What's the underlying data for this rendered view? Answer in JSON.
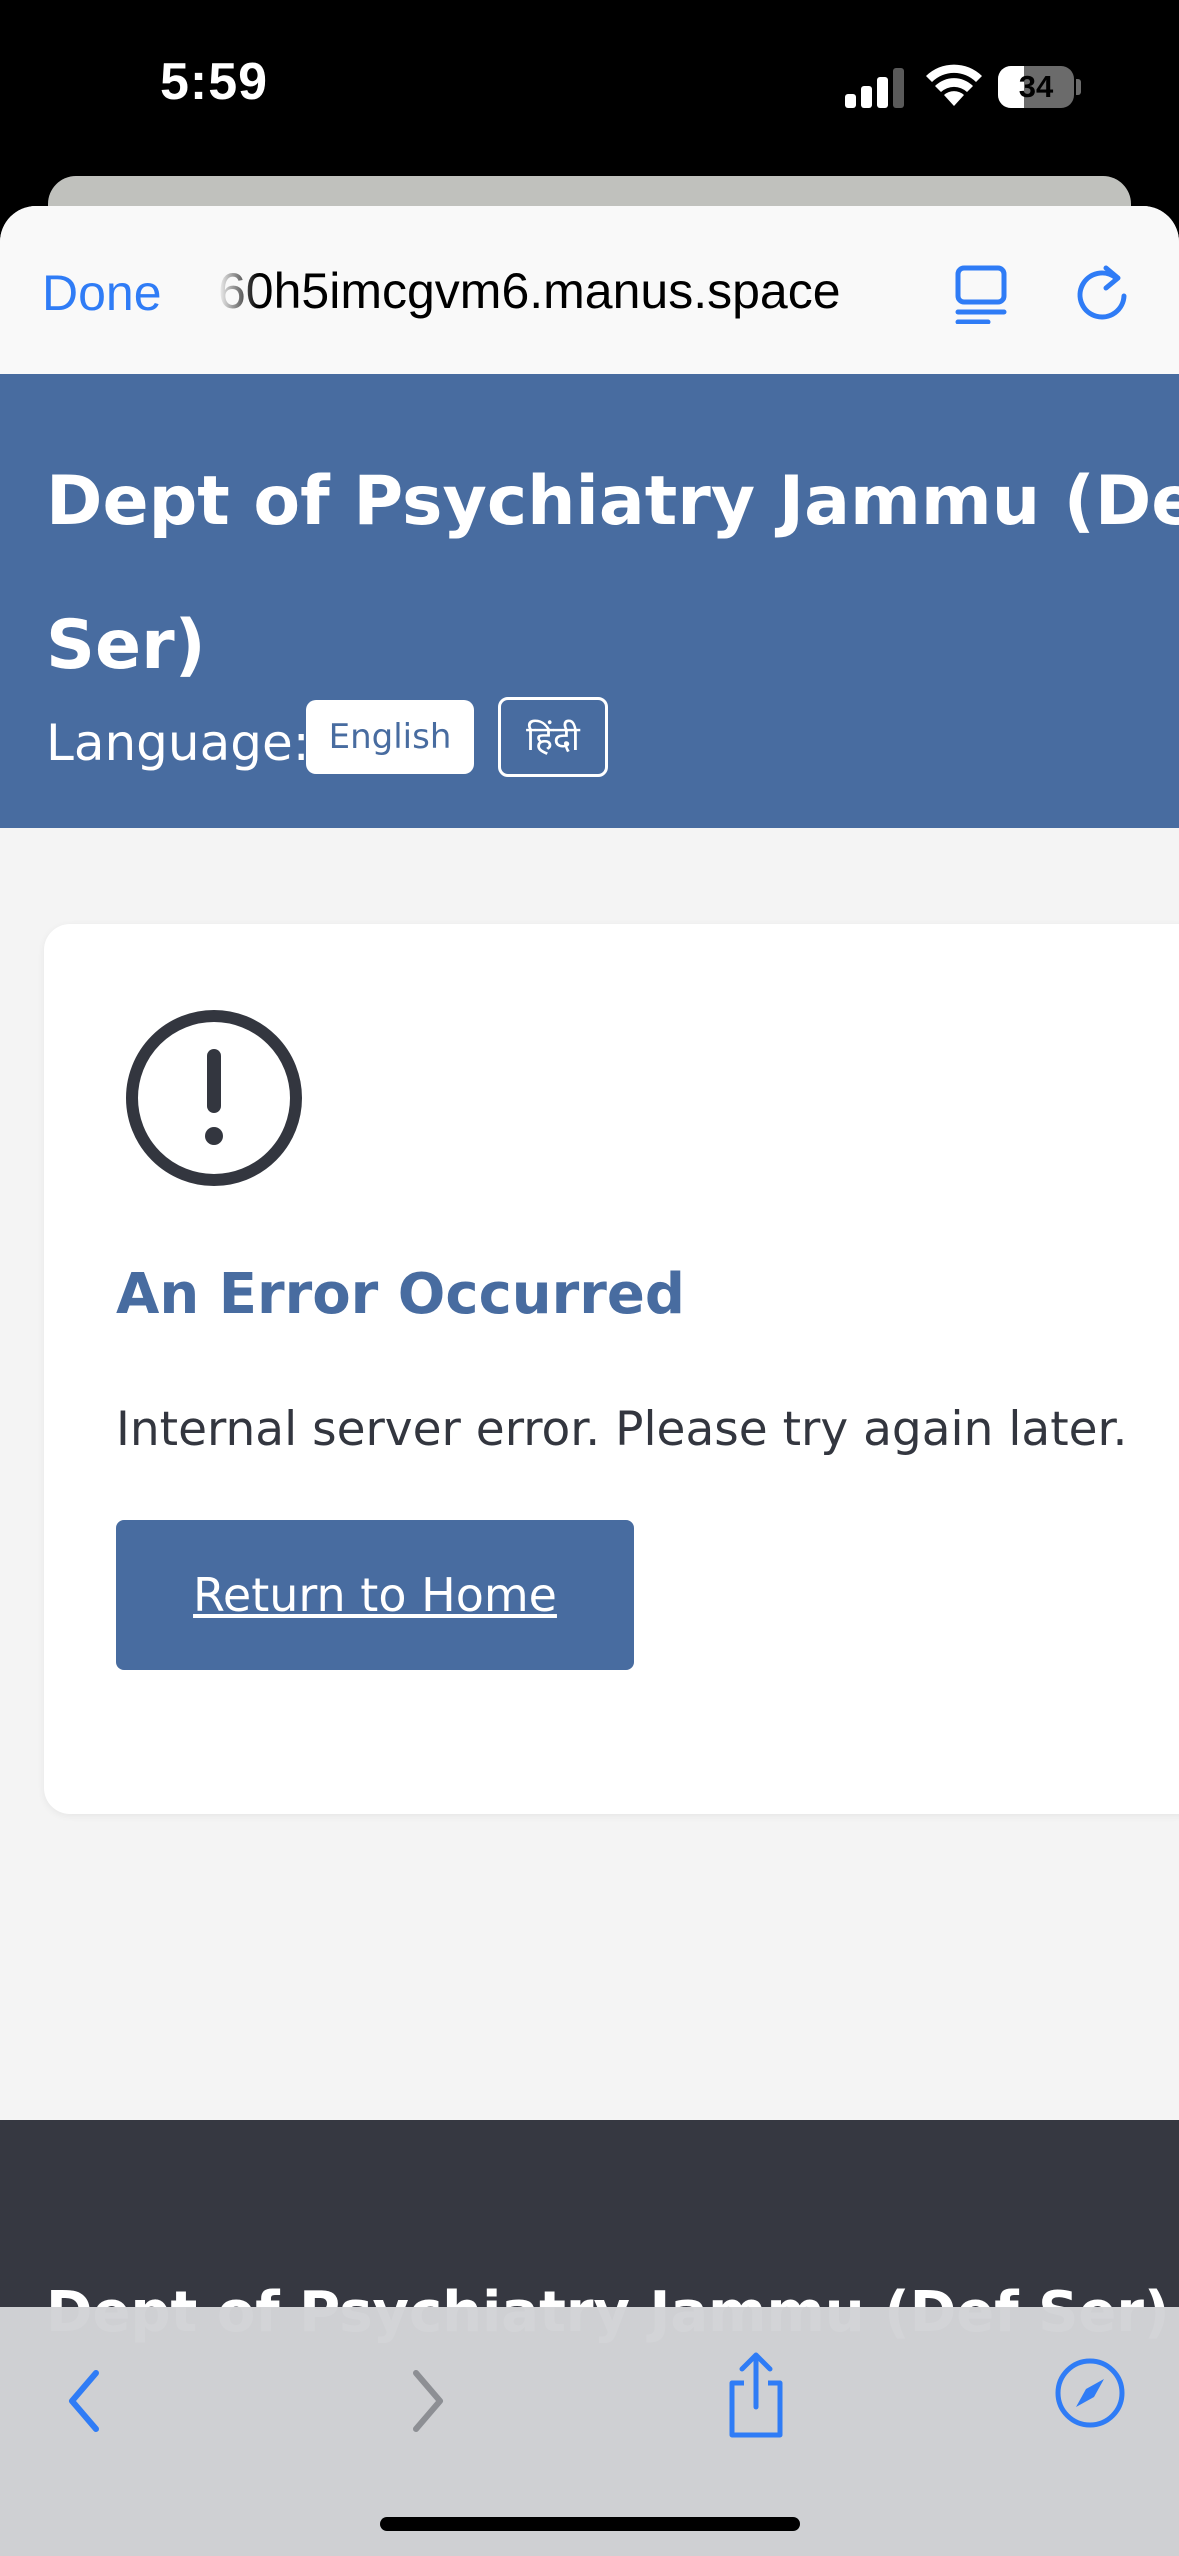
{
  "status_bar": {
    "time": "5:59",
    "battery_percent": 34,
    "battery_label": "34"
  },
  "browser": {
    "done_label": "Done",
    "url": "60h5imcgvm6.manus.space",
    "accent_color": "#2f7cf6"
  },
  "header": {
    "title_line1": "Dept of Psychiatry Jammu (Def",
    "title_line2": "Ser)",
    "language_label": "Language:",
    "languages": [
      "English",
      "हिंदी"
    ],
    "selected_language": "English",
    "color": "#486ca0"
  },
  "error": {
    "icon": "alert-circle-icon",
    "title": "An Error Occurred",
    "message": "Internal server error. Please try again later.",
    "button_label": "Return to Home"
  },
  "footer": {
    "title": "Dept of Psychiatry Jammu (Def Ser)",
    "color": "#363841"
  },
  "toolbar": {
    "icons": [
      "back-icon",
      "forward-icon",
      "share-icon",
      "compass-icon"
    ]
  }
}
